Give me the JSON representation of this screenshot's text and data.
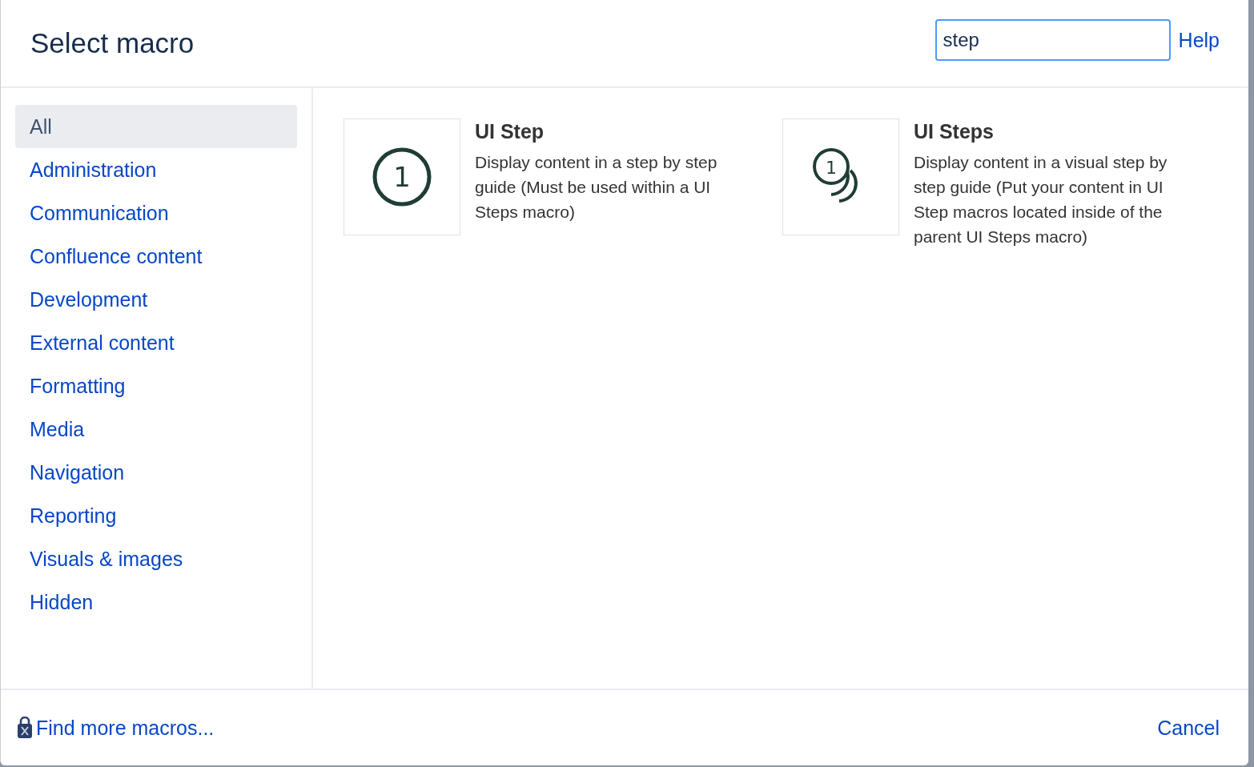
{
  "dialog": {
    "title": "Select macro"
  },
  "search": {
    "value": "step"
  },
  "help_link": "Help",
  "categories": [
    {
      "label": "All",
      "selected": true
    },
    {
      "label": "Administration",
      "selected": false
    },
    {
      "label": "Communication",
      "selected": false
    },
    {
      "label": "Confluence content",
      "selected": false
    },
    {
      "label": "Development",
      "selected": false
    },
    {
      "label": "External content",
      "selected": false
    },
    {
      "label": "Formatting",
      "selected": false
    },
    {
      "label": "Media",
      "selected": false
    },
    {
      "label": "Navigation",
      "selected": false
    },
    {
      "label": "Reporting",
      "selected": false
    },
    {
      "label": "Visuals & images",
      "selected": false
    },
    {
      "label": "Hidden",
      "selected": false
    }
  ],
  "macros": [
    {
      "kind": "single",
      "icon_text": "1",
      "title": "UI Step",
      "description": "Display content in a step by step guide (Must be used within a UI Steps macro)"
    },
    {
      "kind": "stacked",
      "icon_text": "1",
      "title": "UI Steps",
      "description": "Display content in a visual step by step guide (Put your content in UI Step macros located inside of the parent UI Steps macro)"
    }
  ],
  "footer": {
    "find_more": "Find more macros...",
    "cancel": "Cancel"
  }
}
